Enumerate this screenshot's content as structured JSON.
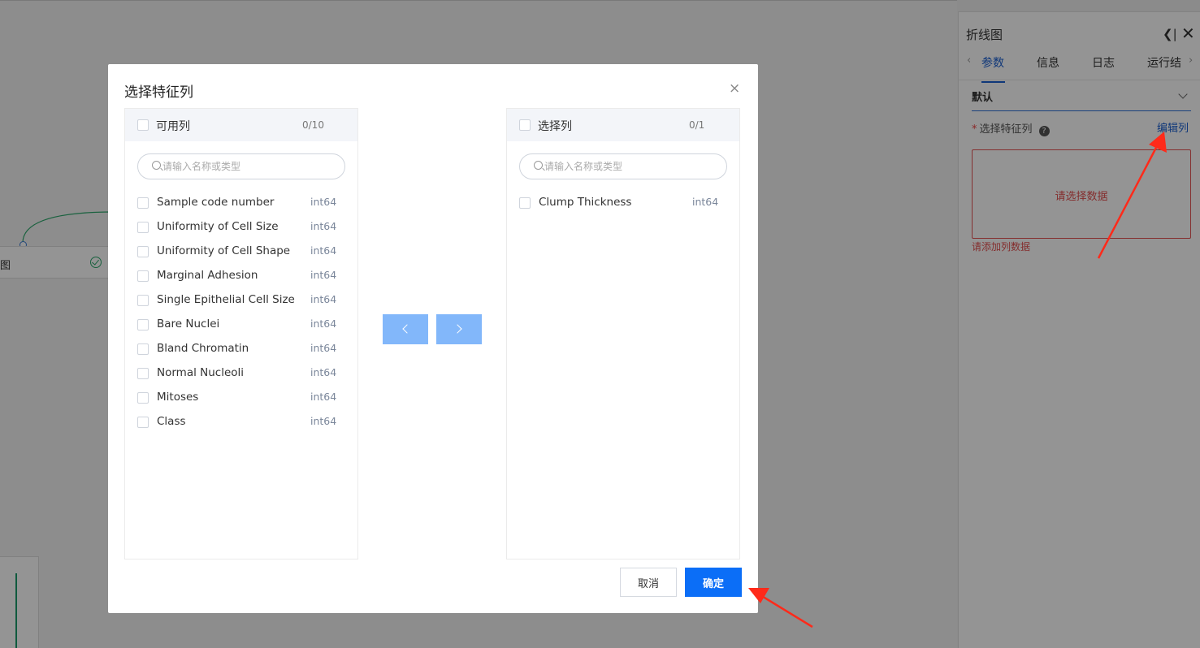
{
  "canvas": {
    "node_label": "图"
  },
  "right_panel": {
    "title": "折线图",
    "collapse_icon": "collapse-icon",
    "close_icon": "close-icon",
    "tabs": [
      {
        "label": "参数",
        "active": true
      },
      {
        "label": "信息",
        "active": false
      },
      {
        "label": "日志",
        "active": false
      },
      {
        "label": "运行结",
        "active": false
      }
    ],
    "section_title": "默认",
    "field_required_mark": "*",
    "field_label": "选择特征列",
    "help_glyph": "?",
    "edit_link": "编辑列",
    "empty_placeholder": "请选择数据",
    "error_text": "请添加列数据"
  },
  "modal": {
    "title": "选择特征列",
    "close_glyph": "×",
    "left_panel": {
      "title": "可用列",
      "count": "0/10",
      "search_placeholder": "请输入名称或类型",
      "items": [
        {
          "name": "Sample code number",
          "type": "int64"
        },
        {
          "name": "Uniformity of Cell Size",
          "type": "int64"
        },
        {
          "name": "Uniformity of Cell Shape",
          "type": "int64"
        },
        {
          "name": "Marginal Adhesion",
          "type": "int64"
        },
        {
          "name": "Single Epithelial Cell Size",
          "type": "int64"
        },
        {
          "name": "Bare Nuclei",
          "type": "int64"
        },
        {
          "name": "Bland Chromatin",
          "type": "int64"
        },
        {
          "name": "Normal Nucleoli",
          "type": "int64"
        },
        {
          "name": "Mitoses",
          "type": "int64"
        },
        {
          "name": "Class",
          "type": "int64"
        }
      ]
    },
    "right_panel": {
      "title": "选择列",
      "count": "0/1",
      "search_placeholder": "请输入名称或类型",
      "items": [
        {
          "name": "Clump Thickness",
          "type": "int64"
        }
      ]
    },
    "cancel_label": "取消",
    "confirm_label": "确定"
  },
  "colors": {
    "primary": "#0b6ef7",
    "arrow_button": "#82b7fa",
    "error": "#e35050",
    "annotation_arrow": "#ff2a1a"
  }
}
